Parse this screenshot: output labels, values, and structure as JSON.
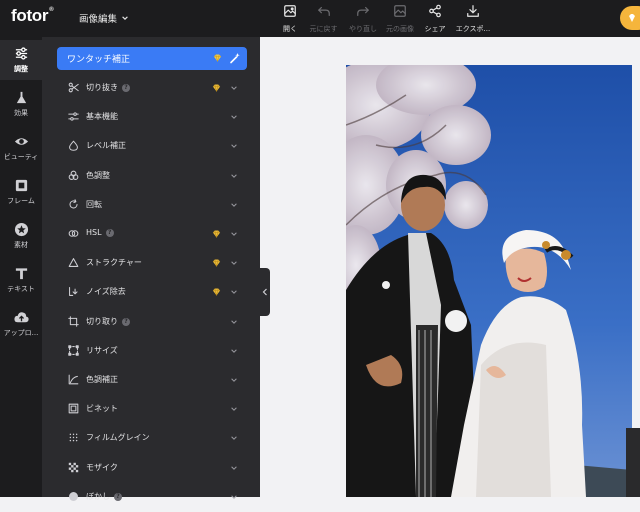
{
  "app": {
    "logo": "fotor",
    "logo_mark": "®",
    "menu": "画像編集"
  },
  "toolbar": [
    {
      "label": "開く",
      "icon": "image-icon",
      "enabled": true
    },
    {
      "label": "元に戻す",
      "icon": "undo-icon",
      "enabled": false
    },
    {
      "label": "やり直し",
      "icon": "redo-icon",
      "enabled": false
    },
    {
      "label": "元の画像",
      "icon": "original-image-icon",
      "enabled": false
    },
    {
      "label": "シェア",
      "icon": "share-icon",
      "enabled": true
    },
    {
      "label": "エクスポ...",
      "icon": "download-icon",
      "enabled": true
    }
  ],
  "leftnav": [
    {
      "label": "調整",
      "icon": "sliders-icon",
      "active": true
    },
    {
      "label": "効果",
      "icon": "flask-icon",
      "active": false
    },
    {
      "label": "ビューティ",
      "icon": "eye-icon",
      "active": false
    },
    {
      "label": "フレーム",
      "icon": "frame-icon",
      "active": false
    },
    {
      "label": "素材",
      "icon": "star-circle-icon",
      "active": false
    },
    {
      "label": "テキスト",
      "icon": "text-icon",
      "active": false
    },
    {
      "label": "アップロ...",
      "icon": "cloud-upload-icon",
      "active": false
    }
  ],
  "panel": {
    "primary": {
      "label": "ワンタッチ補正"
    },
    "items": [
      {
        "label": "切り抜き",
        "icon": "scissors-icon",
        "help": true,
        "premium": true
      },
      {
        "label": "基本機能",
        "icon": "sliders-icon",
        "help": false,
        "premium": false
      },
      {
        "label": "レベル補正",
        "icon": "drop-icon",
        "help": false,
        "premium": false
      },
      {
        "label": "色調整",
        "icon": "color-circles-icon",
        "help": false,
        "premium": false
      },
      {
        "label": "回転",
        "icon": "rotate-icon",
        "help": false,
        "premium": false
      },
      {
        "label": "HSL",
        "icon": "hsl-icon",
        "help": true,
        "premium": true
      },
      {
        "label": "ストラクチャー",
        "icon": "triangle-icon",
        "help": false,
        "premium": true
      },
      {
        "label": "ノイズ除去",
        "icon": "denoise-icon",
        "help": false,
        "premium": true
      },
      {
        "label": "切り取り",
        "icon": "crop-icon",
        "help": true,
        "premium": false
      },
      {
        "label": "リサイズ",
        "icon": "resize-icon",
        "help": false,
        "premium": false
      },
      {
        "label": "色調補正",
        "icon": "curve-icon",
        "help": false,
        "premium": false
      },
      {
        "label": "ビネット",
        "icon": "vignette-icon",
        "help": false,
        "premium": false
      },
      {
        "label": "フィルムグレイン",
        "icon": "grain-icon",
        "help": false,
        "premium": false
      },
      {
        "label": "モザイク",
        "icon": "mosaic-icon",
        "help": false,
        "premium": false
      },
      {
        "label": "ぼかし",
        "icon": "blur-icon",
        "help": true,
        "premium": false
      }
    ],
    "help_mark": "?"
  },
  "colors": {
    "accent": "#3a7bf5",
    "premium": "#e8b93a",
    "bg_dark": "#1c1c1e",
    "panel": "#2b2b2e"
  }
}
